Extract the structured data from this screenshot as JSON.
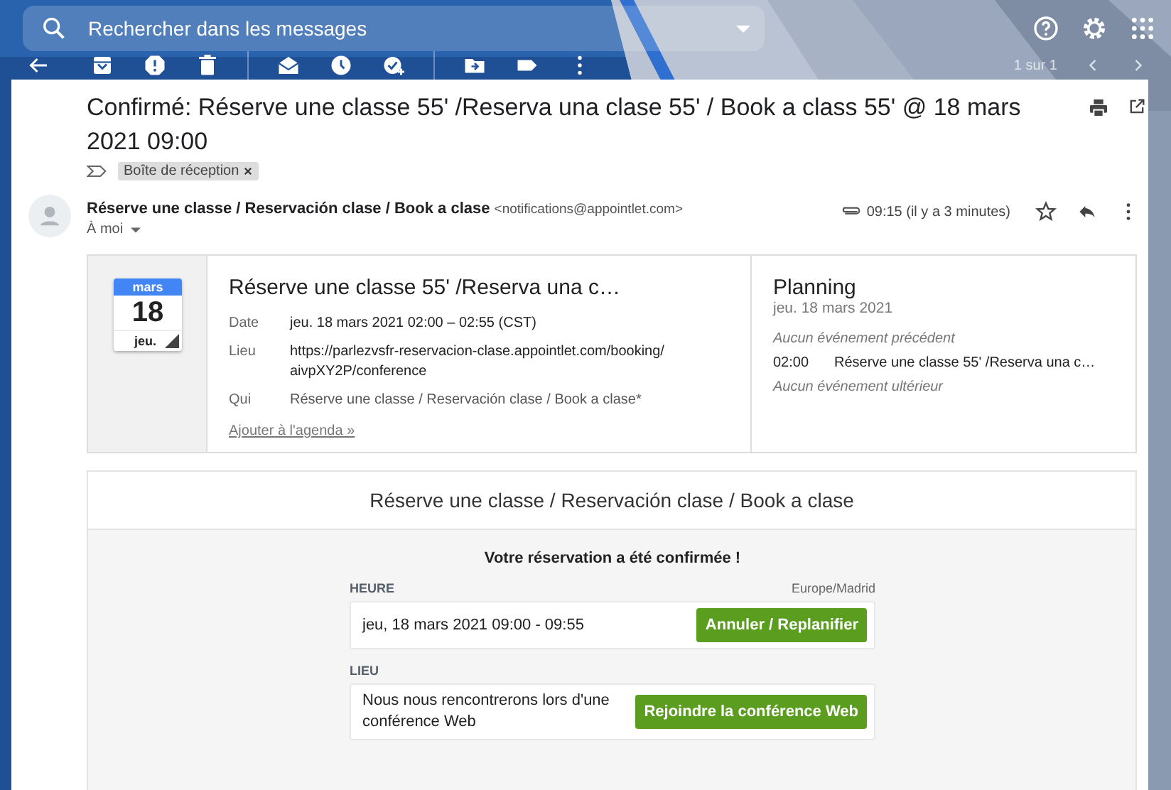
{
  "search": {
    "placeholder": "Rechercher dans les messages"
  },
  "toolbar": {
    "pager": "1 sur 1"
  },
  "message": {
    "subject": "Confirmé: Réserve une classe 55' /Reserva una clase 55' / Book a class 55' @ 18 mars 2021 09:00",
    "labels": [
      {
        "text": "Boîte de réception"
      }
    ],
    "sender": {
      "name": "Réserve une classe / Reservación clase / Book a clase",
      "email": "<notifications@appointlet.com>",
      "to": "À moi",
      "time": "09:15 (il y a 3 minutes)",
      "starred": false
    }
  },
  "event": {
    "month": "mars",
    "day": "18",
    "weekday": "jeu.",
    "title": "Réserve une classe 55' /Reserva una c…",
    "details": [
      {
        "label": "Date",
        "value": "jeu. 18 mars 2021 02:00 – 02:55 (CST)"
      },
      {
        "label": "Lieu",
        "value": "https://parlezvsfr-reservacion-clase.appointlet.com/booking/ aivpXY2P/conference"
      },
      {
        "label": "Qui",
        "value": "Réserve une classe / Reservación clase / Book a clase*"
      }
    ],
    "add_link": "Ajouter à l'agenda »"
  },
  "planning": {
    "title": "Planning",
    "date": "jeu. 18 mars 2021",
    "items": [
      {
        "kind": "note",
        "text": "Aucun événement précédent"
      },
      {
        "kind": "event",
        "time": "02:00",
        "text": "Réserve une classe 55' /Reserva una c…"
      },
      {
        "kind": "note",
        "text": "Aucun événement ultérieur"
      }
    ]
  },
  "body": {
    "header": "Réserve une classe / Reservación clase / Book a clase",
    "confirmation": "Votre réservation a été confirmée !",
    "sections": [
      {
        "label": "HEURE",
        "aside": "Europe/Madrid",
        "text": "jeu, 18 mars 2021 09:00 - 09:55",
        "button": "Annuler / Replanifier"
      },
      {
        "label": "LIEU",
        "text": "Nous nous rencontrerons lors d'une conférence Web",
        "button": "Rejoindre la conférence Web"
      }
    ]
  }
}
